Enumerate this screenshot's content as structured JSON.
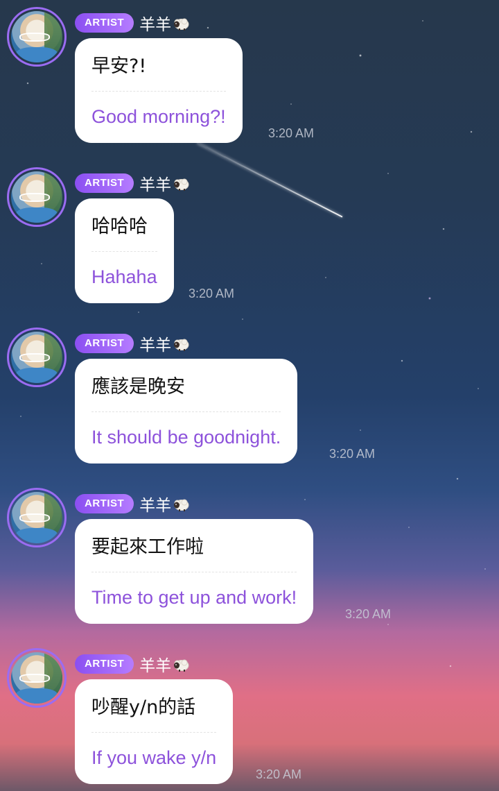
{
  "chat": {
    "messages": [
      {
        "badge": "ARTIST",
        "sender": "羊羊",
        "original": "早安?!",
        "translation": "Good morning?!",
        "time": "3:20 AM"
      },
      {
        "badge": "ARTIST",
        "sender": "羊羊",
        "original": "哈哈哈",
        "translation": "Hahaha",
        "time": "3:20 AM"
      },
      {
        "badge": "ARTIST",
        "sender": "羊羊",
        "original": "應該是晚安",
        "translation": "It should be goodnight.",
        "time": "3:20 AM"
      },
      {
        "badge": "ARTIST",
        "sender": "羊羊",
        "original": "要起來工作啦",
        "translation": "Time to get up and work!",
        "time": "3:20 AM"
      },
      {
        "badge": "ARTIST",
        "sender": "羊羊",
        "original": "吵醒y/n的話",
        "translation": "If you wake y/n",
        "time": "3:20 AM"
      }
    ]
  },
  "icons": {
    "sender_emoji": "sheep-icon",
    "avatar": "artist-avatar"
  },
  "colors": {
    "badge_gradient_start": "#8b4ff1",
    "badge_gradient_end": "#b57cff",
    "translation_text": "#8d52db",
    "avatar_ring": "#9b6cf2",
    "bubble_background": "#ffffff"
  }
}
